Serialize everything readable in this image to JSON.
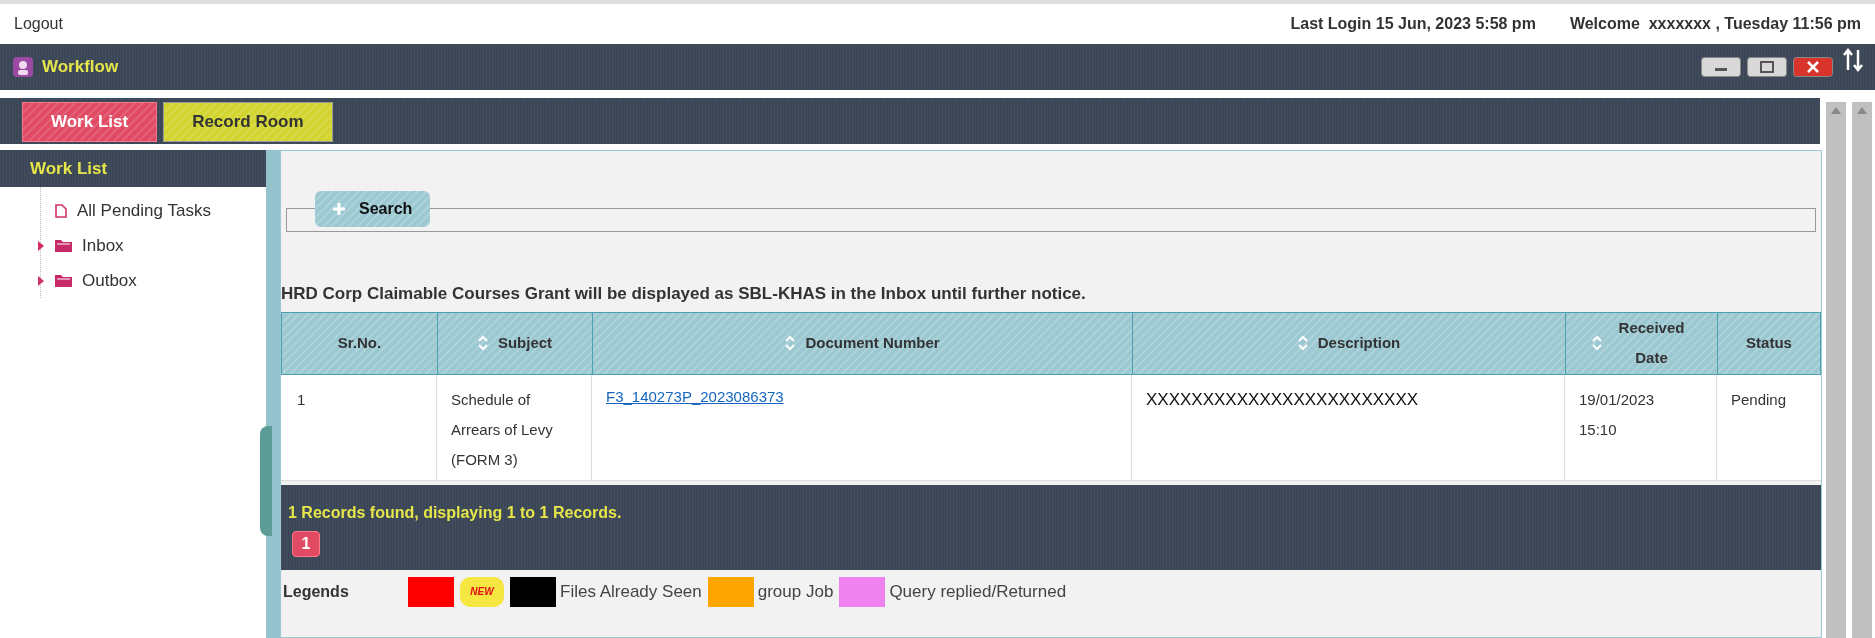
{
  "top_bar": {
    "logout": "Logout",
    "last_login": "Last Login 15 Jun, 2023 5:58 pm",
    "welcome": "Welcome  xxxxxxx , Tuesday 11:56 pm"
  },
  "window": {
    "title": "Workflow"
  },
  "tabs": [
    {
      "label": "Work List",
      "selected": true
    },
    {
      "label": "Record Room",
      "selected": false
    }
  ],
  "sidebar": {
    "title": "Work List",
    "items": [
      {
        "label": "All Pending Tasks",
        "kind": "file"
      },
      {
        "label": "Inbox",
        "kind": "folder",
        "expanded": false
      },
      {
        "label": "Outbox",
        "kind": "folder",
        "expanded": false
      }
    ]
  },
  "search": {
    "label": "Search"
  },
  "notice": "HRD Corp Claimable Courses Grant will be displayed as SBL-KHAS in the Inbox until further notice.",
  "table": {
    "columns": [
      {
        "label": "Sr.No.",
        "sortable": false
      },
      {
        "label": "Subject",
        "sortable": true
      },
      {
        "label": "Document Number",
        "sortable": true
      },
      {
        "label": "Description",
        "sortable": true
      },
      {
        "label": "Received Date",
        "sortable": true
      },
      {
        "label": "Status",
        "sortable": false
      }
    ],
    "rows": [
      [
        "1",
        "Schedule of Arrears of Levy (FORM 3)",
        "F3_140273P_2023086373",
        "XXXXXXXXXXXXXXXXXXXXXXXX",
        "19/01/2023 15:10",
        "Pending"
      ]
    ]
  },
  "records": {
    "summary": "1 Records found, displaying 1 to 1 Records.",
    "pages": [
      {
        "label": "1",
        "selected": true
      }
    ]
  },
  "legends": {
    "title": "Legends",
    "items": [
      {
        "kind": "swatch",
        "color": "#ff0000"
      },
      {
        "kind": "badge",
        "text": "NEW"
      },
      {
        "kind": "swatch",
        "color": "#000000",
        "label": "Files Already Seen"
      },
      {
        "kind": "swatch",
        "color": "#ffa500",
        "label": "group Job"
      },
      {
        "kind": "swatch",
        "color": "#ee82ee",
        "label": "Query replied/Returned"
      }
    ]
  }
}
